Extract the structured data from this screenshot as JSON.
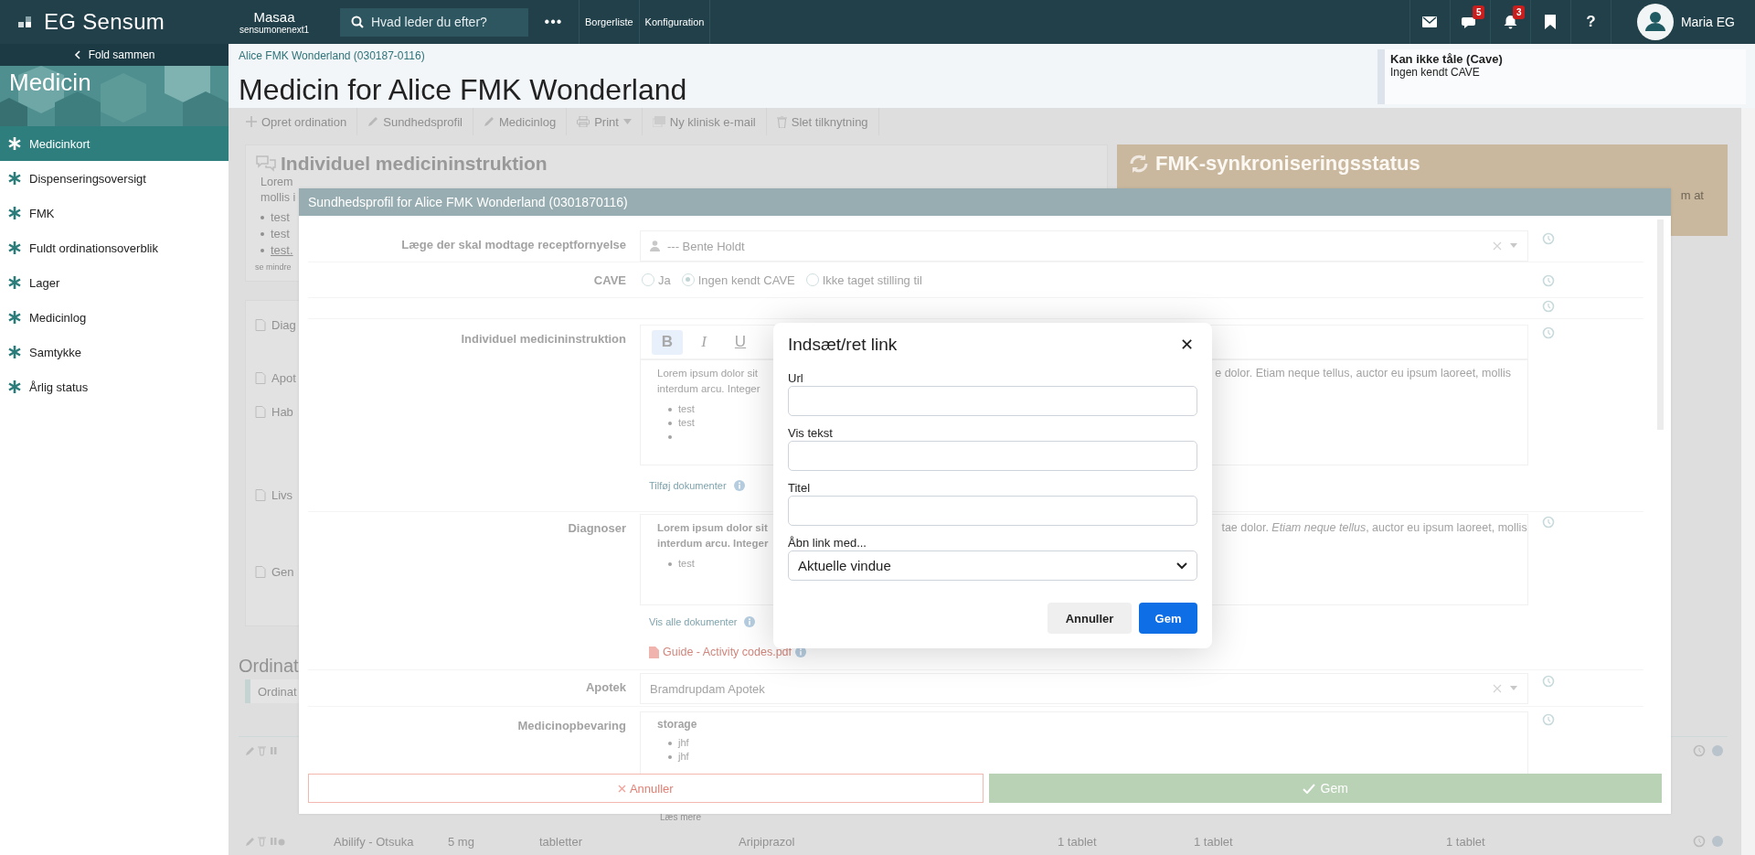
{
  "topbar": {
    "logo": "EG Sensum",
    "org": "Masaa",
    "org_sub": "sensumonenext1",
    "search": {
      "placeholder": "Hvad leder du efter?"
    },
    "more": "•••",
    "links": [
      "Borgerliste",
      "Konfiguration"
    ],
    "icons": [
      {
        "kind": "mail"
      },
      {
        "kind": "chat",
        "badge": "5"
      },
      {
        "kind": "bell",
        "badge": "3"
      },
      {
        "kind": "bookmark"
      },
      {
        "kind": "help",
        "label": "?"
      }
    ],
    "user": "Maria EG"
  },
  "sidebar": {
    "collapse": "Fold sammen",
    "title": "Medicin",
    "items": [
      {
        "label": "Medicinkort",
        "selected": true
      },
      {
        "label": "Dispenseringsoversigt",
        "selected": false
      },
      {
        "label": "FMK",
        "selected": false
      },
      {
        "label": "Fuldt ordinationsoverblik",
        "selected": false
      },
      {
        "label": "Lager",
        "selected": false
      },
      {
        "label": "Medicinlog",
        "selected": false
      },
      {
        "label": "Samtykke",
        "selected": false
      },
      {
        "label": "Årlig status",
        "selected": false
      }
    ]
  },
  "header": {
    "breadcrumb": "Alice FMK Wonderland (030187-0116)",
    "title": "Medicin for Alice FMK Wonderland",
    "cave": {
      "title": "Kan ikke tåle (Cave)",
      "text": "Ingen kendt CAVE"
    }
  },
  "toolbar": [
    {
      "kind": "plus",
      "label": "Opret ordination"
    },
    {
      "kind": "pencil",
      "label": "Sundhedsprofil"
    },
    {
      "kind": "pencil",
      "label": "Medicinlog"
    },
    {
      "kind": "print",
      "label": "Print"
    },
    {
      "kind": "mail",
      "label": "Ny klinisk e-mail"
    },
    {
      "kind": "trash",
      "label": "Slet tilknytning"
    }
  ],
  "background": {
    "instruction_card": {
      "title": "Individuel medicininstruktion",
      "lines": [
        "Lorem",
        "mollis i"
      ],
      "list": [
        "test",
        "test",
        "test."
      ],
      "toggle": "se mindre"
    },
    "side_items": [
      "Diag",
      "Apot",
      "Hab",
      "Livs",
      "Gen"
    ],
    "fmk": {
      "title": "FMK-synkroniseringsstatus",
      "text": "m at"
    },
    "orders_heading": "Ordinat",
    "orders_tab": "Ordinat",
    "read_more": "Læs mere",
    "row": [
      "Abilify - Otsuka",
      "5 mg",
      "tabletter",
      "Aripiprazol",
      "1 tablet",
      "1 tablet",
      "1 tablet"
    ]
  },
  "dialog": {
    "title": "Sundhedsprofil for Alice FMK Wonderland (0301870116)",
    "rows": [
      {
        "kind": "select",
        "label": "Læge der skal modtage receptfornyelse",
        "value": "--- Bente Holdt",
        "person": true
      },
      {
        "kind": "radio",
        "label": "CAVE",
        "options": [
          {
            "label": "Ja",
            "selected": false
          },
          {
            "label": "Ingen kendt CAVE",
            "selected": true
          },
          {
            "label": "Ikke taget stilling til",
            "selected": false
          }
        ]
      },
      {
        "kind": "blank"
      },
      {
        "kind": "editor",
        "label": "Individuel medicininstruktion",
        "format_buttons": [
          {
            "label": "B",
            "selected": true
          },
          {
            "label": "I",
            "selected": false
          },
          {
            "label": "U",
            "selected": false
          }
        ],
        "left_lines": [
          "Lorem ipsum dolor sit",
          "interdum arcu. Integer"
        ],
        "right_text": "e dolor. Etiam neque tellus, auctor eu ipsum laoreet, mollis",
        "list": [
          "test",
          "test"
        ],
        "empty_bullet": true,
        "links": [
          "Tilføj dokumenter"
        ]
      },
      {
        "kind": "editor",
        "label": "Diagnoser",
        "left_lines": [
          "Lorem ipsum dolor sit",
          "interdum arcu. Integer"
        ],
        "right_text": "tae dolor. *Etiam neque tellus*, auctor eu ipsum laoreet, mollis",
        "list": [
          "test"
        ],
        "empty_bullet": false,
        "links": [
          "Vis alle dokumenter"
        ],
        "file": "Guide - Activity codes.pdf"
      },
      {
        "kind": "select",
        "label": "Apotek",
        "value": "Bramdrupdam Apotek",
        "person": false
      },
      {
        "kind": "notes",
        "label": "Medicinopbevaring",
        "heading": "storage",
        "list": [
          "jhf",
          "jhf"
        ]
      }
    ],
    "cancel": "Annuller",
    "save": "Gem"
  },
  "link_modal": {
    "title": "Indsæt/ret link",
    "close": "✕",
    "fields": [
      {
        "label": "Url"
      },
      {
        "label": "Vis tekst"
      },
      {
        "label": "Titel"
      }
    ],
    "target": {
      "label": "Åbn link med...",
      "value": "Aktuelle vindue"
    },
    "cancel": "Annuller",
    "save": "Gem"
  }
}
